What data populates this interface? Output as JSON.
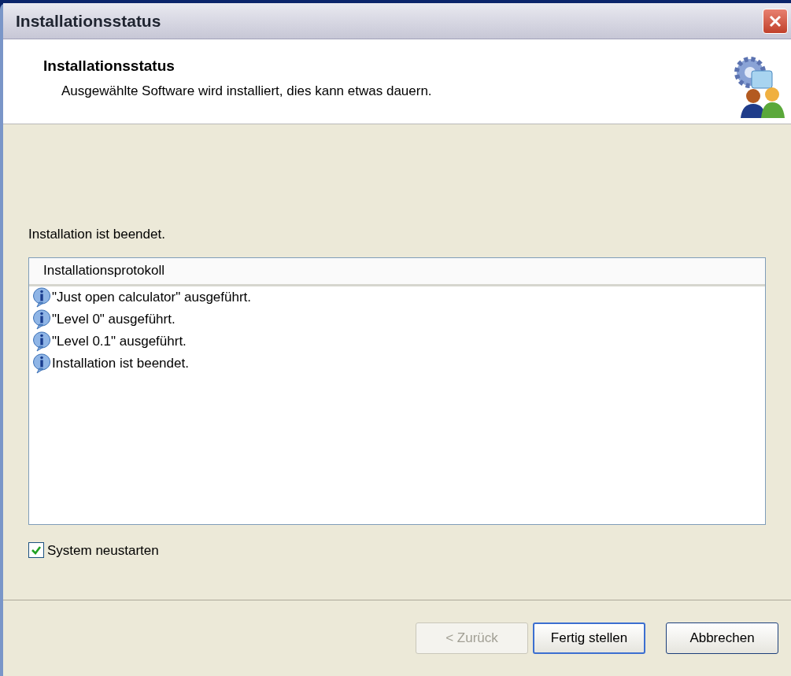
{
  "window": {
    "title": "Installationsstatus"
  },
  "header": {
    "title": "Installationsstatus",
    "subtitle": "Ausgewählte Software wird installiert, dies kann etwas dauern."
  },
  "status_text": "Installation ist beendet.",
  "log": {
    "column": "Installationsprotokoll",
    "rows": [
      {
        "kind": "info",
        "text": "\"Just open calculator\" ausgeführt."
      },
      {
        "kind": "info",
        "text": "\"Level 0\" ausgeführt."
      },
      {
        "kind": "info",
        "text": "\"Level 0.1\" ausgeführt."
      },
      {
        "kind": "info",
        "text": "Installation ist beendet."
      }
    ]
  },
  "restart": {
    "label": "System neustarten",
    "checked": true
  },
  "buttons": [
    {
      "label": "< Zurück",
      "disabled": true,
      "default": false
    },
    {
      "label": "Fertig stellen",
      "disabled": false,
      "default": true
    },
    {
      "label": "Abbrechen",
      "disabled": false,
      "default": false
    }
  ]
}
